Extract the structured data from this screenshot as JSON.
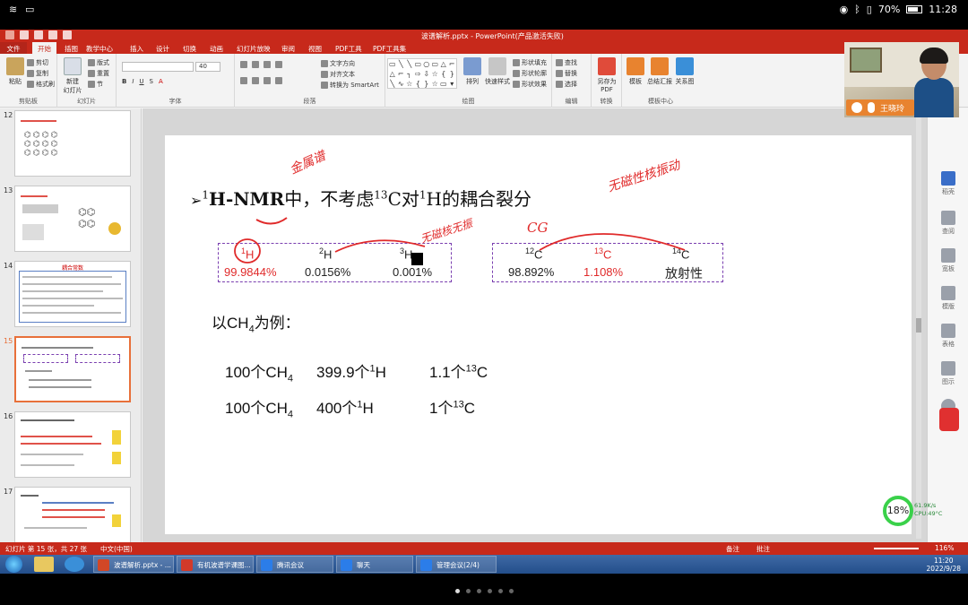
{
  "tablet": {
    "clock": "11:28",
    "battery": "70%"
  },
  "window": {
    "title": "波谱解析.pptx - PowerPoint(产品激活失败)"
  },
  "ribbon_tabs": [
    "文件",
    "开始",
    "插图",
    "教学中心",
    "插入",
    "设计",
    "切换",
    "动画",
    "幻灯片放映",
    "审阅",
    "视图",
    "PDF工具",
    "PDF工具集"
  ],
  "ribbon": {
    "paste": "粘贴",
    "cut": "剪切",
    "copy": "复制",
    "format_painter": "格式刷",
    "new_slide": "新建\n幻灯片",
    "layout": "版式",
    "reset": "重置",
    "section": "节",
    "font_size": "40",
    "text_dir": "文字方向",
    "align_text": "对齐文本",
    "smartart": "转换为 SmartArt",
    "arrange": "排列",
    "quick_styles": "快速样式",
    "shape_fill": "形状填充",
    "shape_outline": "形状轮廓",
    "shape_effect": "形状效果",
    "find": "查找",
    "replace": "替换",
    "select": "选择",
    "save_pdf": "另存为PDF",
    "template": "模板",
    "report": "总结汇报",
    "relation": "关系图",
    "groups": {
      "clipboard": "剪贴板",
      "slides": "幻灯片",
      "font": "字体",
      "paragraph": "段落",
      "drawing": "绘图",
      "editing": "编辑",
      "convert": "转换",
      "template_center": "模板中心"
    }
  },
  "thumbnails": [
    {
      "num": "12"
    },
    {
      "num": "13"
    },
    {
      "num": "14",
      "heading": "耦合常数"
    },
    {
      "num": "15"
    },
    {
      "num": "16"
    },
    {
      "num": "17"
    }
  ],
  "slide": {
    "title_prefix": "➢",
    "title_iso": "1",
    "title_nmr": "H-NMR",
    "title_rest_1": "中，不考虑",
    "title_iso2": "13",
    "title_rest_2": "C对",
    "title_iso3": "1",
    "title_rest_3": "H的耦合裂分",
    "h_isotopes": [
      {
        "mass": "1",
        "el": "H",
        "abundance": "99.9844%"
      },
      {
        "mass": "2",
        "el": "H",
        "abundance": "0.0156%"
      },
      {
        "mass": "3",
        "el": "H",
        "abundance": "0.001%"
      }
    ],
    "c_isotopes": [
      {
        "mass": "12",
        "el": "C",
        "abundance": "98.892%"
      },
      {
        "mass": "13",
        "el": "C",
        "abundance": "1.108%"
      },
      {
        "mass": "14",
        "el": "C",
        "abundance": "放射性"
      }
    ],
    "example_label_a": "以CH",
    "example_sub": "4",
    "example_label_b": "为例：",
    "row1": {
      "a": "100个CH",
      "a_sub": "4",
      "b": "399.9个",
      "b_sup": "1",
      "b_el": "H",
      "c": "1.1个",
      "c_sup": "13",
      "c_el": "C"
    },
    "row2": {
      "a": "100个CH",
      "a_sub": "4",
      "b": "400个",
      "b_sup": "1",
      "b_el": "H",
      "c": "1个",
      "c_sup": "13",
      "c_el": "C"
    },
    "handwriting": {
      "note1": "金属谱",
      "note2": "无磁核无振",
      "note3": "无磁性核振动",
      "note4": "CG"
    }
  },
  "right_sidebar": [
    "稻壳",
    "查阅",
    "宽板",
    "模版",
    "表格",
    "图示",
    "形象"
  ],
  "statusbar": {
    "slide_info": "幻灯片 第 15 张，共 27 张",
    "lang": "中文(中国)",
    "notes": "备注",
    "comments": "批注",
    "zoom": "116%"
  },
  "taskbar": {
    "apps": [
      "波谱解析.pptx - ...",
      "有机波谱学课图...",
      "腾讯会议",
      "聊天",
      "管理会议(2/4)"
    ],
    "time": "11:20",
    "date": "2022/9/28"
  },
  "cam": {
    "name": "王晓玲"
  },
  "cpu": {
    "percent": "18%",
    "net": "61.9K/s",
    "cpu": "CPU:49°C"
  }
}
